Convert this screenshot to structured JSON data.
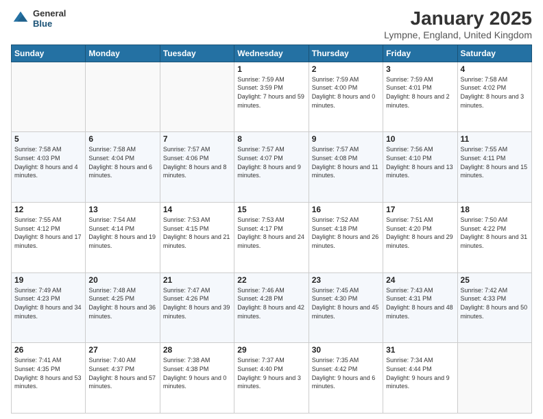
{
  "header": {
    "logo_general": "General",
    "logo_blue": "Blue",
    "month_title": "January 2025",
    "location": "Lympne, England, United Kingdom"
  },
  "weekdays": [
    "Sunday",
    "Monday",
    "Tuesday",
    "Wednesday",
    "Thursday",
    "Friday",
    "Saturday"
  ],
  "weeks": [
    [
      {
        "day": "",
        "sunrise": "",
        "sunset": "",
        "daylight": ""
      },
      {
        "day": "",
        "sunrise": "",
        "sunset": "",
        "daylight": ""
      },
      {
        "day": "",
        "sunrise": "",
        "sunset": "",
        "daylight": ""
      },
      {
        "day": "1",
        "sunrise": "7:59 AM",
        "sunset": "3:59 PM",
        "daylight": "7 hours and 59 minutes."
      },
      {
        "day": "2",
        "sunrise": "7:59 AM",
        "sunset": "4:00 PM",
        "daylight": "8 hours and 0 minutes."
      },
      {
        "day": "3",
        "sunrise": "7:59 AM",
        "sunset": "4:01 PM",
        "daylight": "8 hours and 2 minutes."
      },
      {
        "day": "4",
        "sunrise": "7:58 AM",
        "sunset": "4:02 PM",
        "daylight": "8 hours and 3 minutes."
      }
    ],
    [
      {
        "day": "5",
        "sunrise": "7:58 AM",
        "sunset": "4:03 PM",
        "daylight": "8 hours and 4 minutes."
      },
      {
        "day": "6",
        "sunrise": "7:58 AM",
        "sunset": "4:04 PM",
        "daylight": "8 hours and 6 minutes."
      },
      {
        "day": "7",
        "sunrise": "7:57 AM",
        "sunset": "4:06 PM",
        "daylight": "8 hours and 8 minutes."
      },
      {
        "day": "8",
        "sunrise": "7:57 AM",
        "sunset": "4:07 PM",
        "daylight": "8 hours and 9 minutes."
      },
      {
        "day": "9",
        "sunrise": "7:57 AM",
        "sunset": "4:08 PM",
        "daylight": "8 hours and 11 minutes."
      },
      {
        "day": "10",
        "sunrise": "7:56 AM",
        "sunset": "4:10 PM",
        "daylight": "8 hours and 13 minutes."
      },
      {
        "day": "11",
        "sunrise": "7:55 AM",
        "sunset": "4:11 PM",
        "daylight": "8 hours and 15 minutes."
      }
    ],
    [
      {
        "day": "12",
        "sunrise": "7:55 AM",
        "sunset": "4:12 PM",
        "daylight": "8 hours and 17 minutes."
      },
      {
        "day": "13",
        "sunrise": "7:54 AM",
        "sunset": "4:14 PM",
        "daylight": "8 hours and 19 minutes."
      },
      {
        "day": "14",
        "sunrise": "7:53 AM",
        "sunset": "4:15 PM",
        "daylight": "8 hours and 21 minutes."
      },
      {
        "day": "15",
        "sunrise": "7:53 AM",
        "sunset": "4:17 PM",
        "daylight": "8 hours and 24 minutes."
      },
      {
        "day": "16",
        "sunrise": "7:52 AM",
        "sunset": "4:18 PM",
        "daylight": "8 hours and 26 minutes."
      },
      {
        "day": "17",
        "sunrise": "7:51 AM",
        "sunset": "4:20 PM",
        "daylight": "8 hours and 29 minutes."
      },
      {
        "day": "18",
        "sunrise": "7:50 AM",
        "sunset": "4:22 PM",
        "daylight": "8 hours and 31 minutes."
      }
    ],
    [
      {
        "day": "19",
        "sunrise": "7:49 AM",
        "sunset": "4:23 PM",
        "daylight": "8 hours and 34 minutes."
      },
      {
        "day": "20",
        "sunrise": "7:48 AM",
        "sunset": "4:25 PM",
        "daylight": "8 hours and 36 minutes."
      },
      {
        "day": "21",
        "sunrise": "7:47 AM",
        "sunset": "4:26 PM",
        "daylight": "8 hours and 39 minutes."
      },
      {
        "day": "22",
        "sunrise": "7:46 AM",
        "sunset": "4:28 PM",
        "daylight": "8 hours and 42 minutes."
      },
      {
        "day": "23",
        "sunrise": "7:45 AM",
        "sunset": "4:30 PM",
        "daylight": "8 hours and 45 minutes."
      },
      {
        "day": "24",
        "sunrise": "7:43 AM",
        "sunset": "4:31 PM",
        "daylight": "8 hours and 48 minutes."
      },
      {
        "day": "25",
        "sunrise": "7:42 AM",
        "sunset": "4:33 PM",
        "daylight": "8 hours and 50 minutes."
      }
    ],
    [
      {
        "day": "26",
        "sunrise": "7:41 AM",
        "sunset": "4:35 PM",
        "daylight": "8 hours and 53 minutes."
      },
      {
        "day": "27",
        "sunrise": "7:40 AM",
        "sunset": "4:37 PM",
        "daylight": "8 hours and 57 minutes."
      },
      {
        "day": "28",
        "sunrise": "7:38 AM",
        "sunset": "4:38 PM",
        "daylight": "9 hours and 0 minutes."
      },
      {
        "day": "29",
        "sunrise": "7:37 AM",
        "sunset": "4:40 PM",
        "daylight": "9 hours and 3 minutes."
      },
      {
        "day": "30",
        "sunrise": "7:35 AM",
        "sunset": "4:42 PM",
        "daylight": "9 hours and 6 minutes."
      },
      {
        "day": "31",
        "sunrise": "7:34 AM",
        "sunset": "4:44 PM",
        "daylight": "9 hours and 9 minutes."
      },
      {
        "day": "",
        "sunrise": "",
        "sunset": "",
        "daylight": ""
      }
    ]
  ]
}
